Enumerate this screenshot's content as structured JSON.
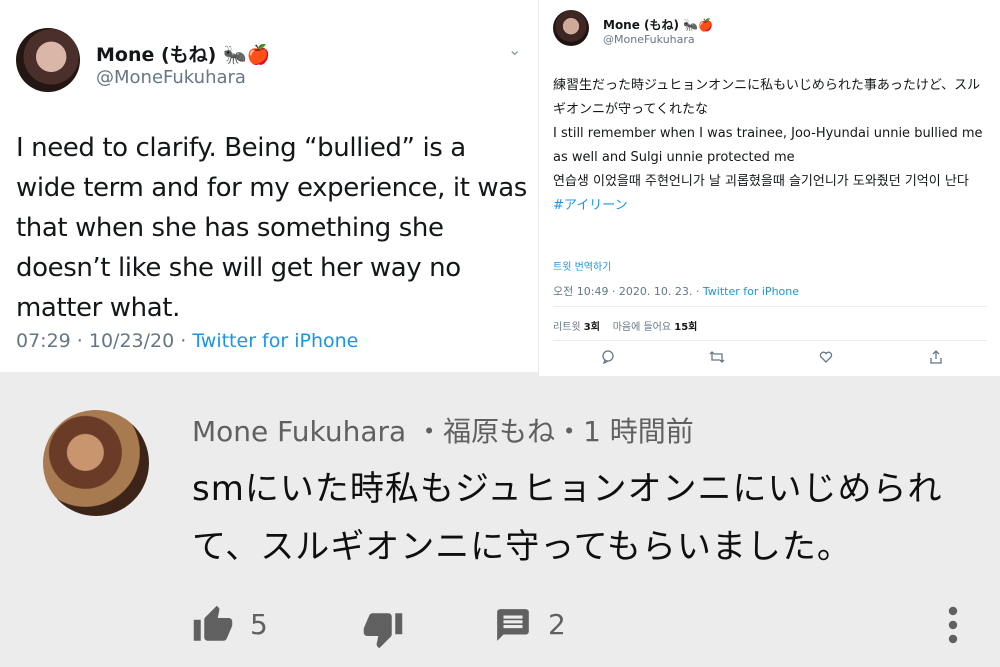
{
  "tweet_left": {
    "name": "Mone (もね) 🐜🍎",
    "handle": "@MoneFukuhara",
    "body": "I need to clarify. Being “bullied” is a wide term and for my experience, it was that when she has something she doesn’t like she will get her way no matter what.",
    "time": "07:29 · 10/23/20 · ",
    "source": "Twitter for iPhone"
  },
  "tweet_right": {
    "name": "Mone (もね) 🐜🍎",
    "handle": "@MoneFukuhara",
    "lines": [
      "練習生だった時ジュヒョンオンニに私もいじめられた事あったけど、スルギオンニが守ってくれたな",
      "I still remember when I was trainee, Joo-Hyundai unnie bullied me as well and Sulgi unnie protected me",
      "연습생 이었을때 주현언니가 날 괴롭혔을때 슬기언니가 도와줬던 기억이 난다"
    ],
    "hashtag": "#アイリーン",
    "translate": "트윗 번역하기",
    "time": "오전 10:49 · 2020. 10. 23. · ",
    "source": "Twitter for iPhone",
    "retweets_label": "리트윗",
    "retweets": "3회",
    "likes_label": "마음에 들어요",
    "likes": "15회"
  },
  "comment": {
    "author": "Mone Fukuhara",
    "meta": "・福原もね・1 時間前",
    "text": "smにいた時私もジュヒョンオンニにいじめられて、スルギオンニに守ってもらいました。",
    "like_count": "5",
    "reply_count": "2"
  },
  "colors": {
    "twitter_blue": "#1b95e0",
    "text_gray": "#657786",
    "comment_bg": "#ececec"
  }
}
